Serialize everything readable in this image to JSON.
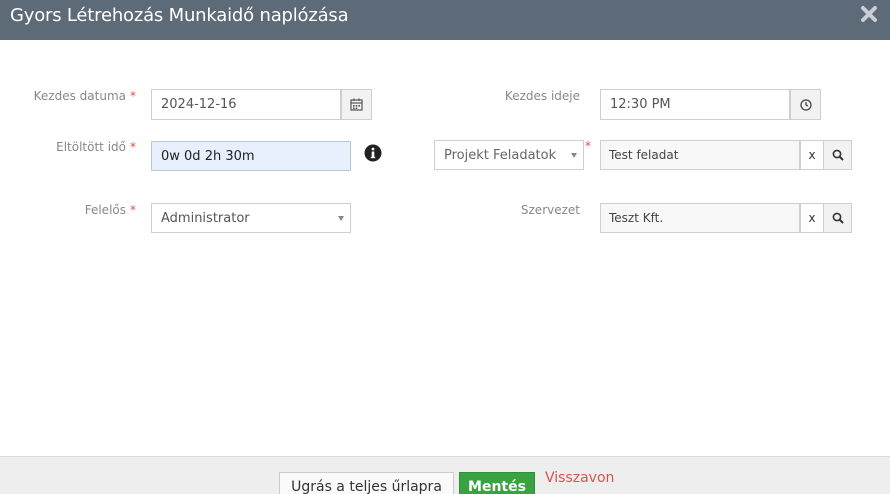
{
  "dialog": {
    "title": "Gyors Létrehozás Munkaidő naplózása",
    "close_icon": "close-x-icon"
  },
  "form": {
    "start_date": {
      "label": "Kezdes datuma",
      "required": "*",
      "value": "2024-12-16",
      "icon": "calendar-icon"
    },
    "start_time": {
      "label": "Kezdes ideje",
      "value": "12:30 PM",
      "icon": "clock-icon"
    },
    "time_spent": {
      "label": "Eltöltött idő",
      "required": "*",
      "value": "0w 0d 2h 30m",
      "info_icon": "info-circle-icon"
    },
    "related": {
      "type_options_selected": "Projekt Feladatok",
      "required": "*",
      "value": "Test feladat",
      "clear_label": "x",
      "search_icon": "search-icon"
    },
    "owner": {
      "label": "Felelős",
      "required": "*",
      "value": "Administrator"
    },
    "organization": {
      "label": "Szervezet",
      "value": "Teszt Kft.",
      "clear_label": "x",
      "search_icon": "search-icon"
    }
  },
  "footer": {
    "full_form_label": "Ugrás a teljes űrlapra",
    "save_label": "Mentés",
    "cancel_label": "Visszavon"
  },
  "colors": {
    "titlebar": "#5d6b79",
    "required": "#d9534f",
    "save": "#38a340",
    "cancel": "#d9534f",
    "highlight": "#e8f0fe"
  }
}
